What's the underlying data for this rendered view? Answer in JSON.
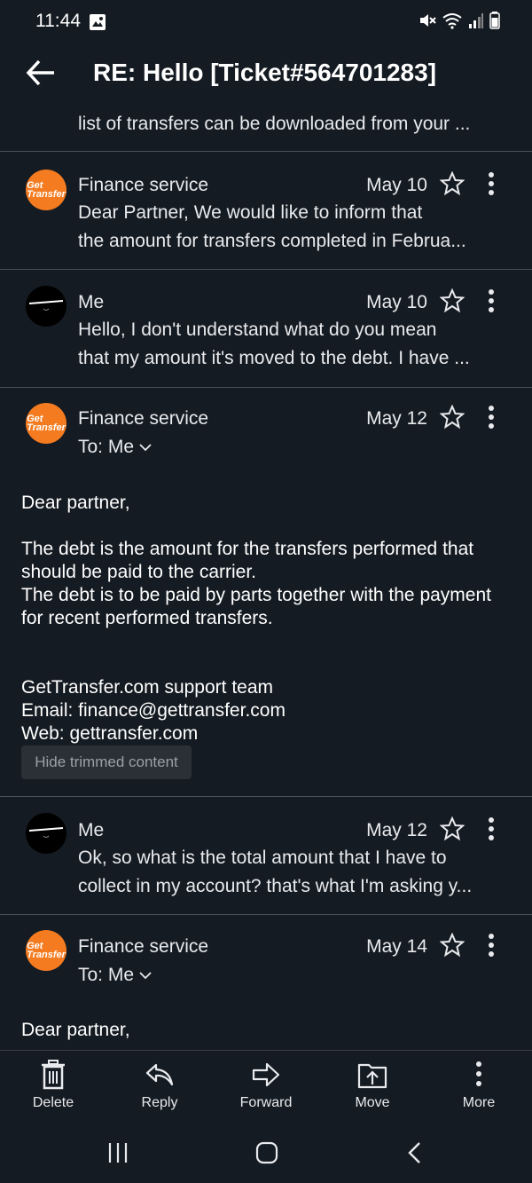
{
  "status": {
    "time": "11:44"
  },
  "header": {
    "title": "RE: Hello [Ticket#564701283]"
  },
  "collapsed_top": {
    "snippet": "list of transfers can be downloaded from your ..."
  },
  "messages": [
    {
      "sender": "Finance service",
      "date": "May 10",
      "avatar": "Get Transfer",
      "snippet1": "Dear Partner, We would like to inform that",
      "snippet2": "the amount for transfers completed in Februa..."
    },
    {
      "sender": "Me",
      "date": "May 10",
      "snippet1": "Hello, I don't understand what do you mean",
      "snippet2": "that my amount it's moved to the debt. I have ..."
    },
    {
      "sender": "Finance service",
      "date": "May 12",
      "to": "To: Me",
      "avatar": "Get Transfer",
      "body": {
        "greeting": "Dear partner,",
        "p1": "The debt is the amount for the transfers performed that should be paid to the carrier.",
        "p2": "The debt is to be paid by parts together with the payment for recent performed transfers.",
        "sig1": "GetTransfer.com support team",
        "sig2": "Email: finance@gettransfer.com",
        "sig3": "Web: gettransfer.com"
      },
      "hide_trimmed": "Hide trimmed content"
    },
    {
      "sender": "Me",
      "date": "May 12",
      "snippet1": "Ok, so what is the total amount that I have to",
      "snippet2": "collect in my account? that's what I'm asking y..."
    },
    {
      "sender": "Finance service",
      "date": "May 14",
      "to": "To: Me",
      "avatar": "Get Transfer",
      "greeting": "Dear partner,"
    }
  ],
  "toolbar": {
    "delete": "Delete",
    "reply": "Reply",
    "forward": "Forward",
    "move": "Move",
    "more": "More"
  },
  "icons": [
    "back-arrow-icon",
    "star-icon",
    "more-vert-icon",
    "chevron-down-icon",
    "trash-icon",
    "reply-icon",
    "forward-icon",
    "move-icon",
    "recents-icon",
    "home-icon",
    "back-nav-icon"
  ],
  "colors": {
    "background": "#151b22",
    "avatar_brand": "#f47b20",
    "divider": "#4a5058"
  }
}
